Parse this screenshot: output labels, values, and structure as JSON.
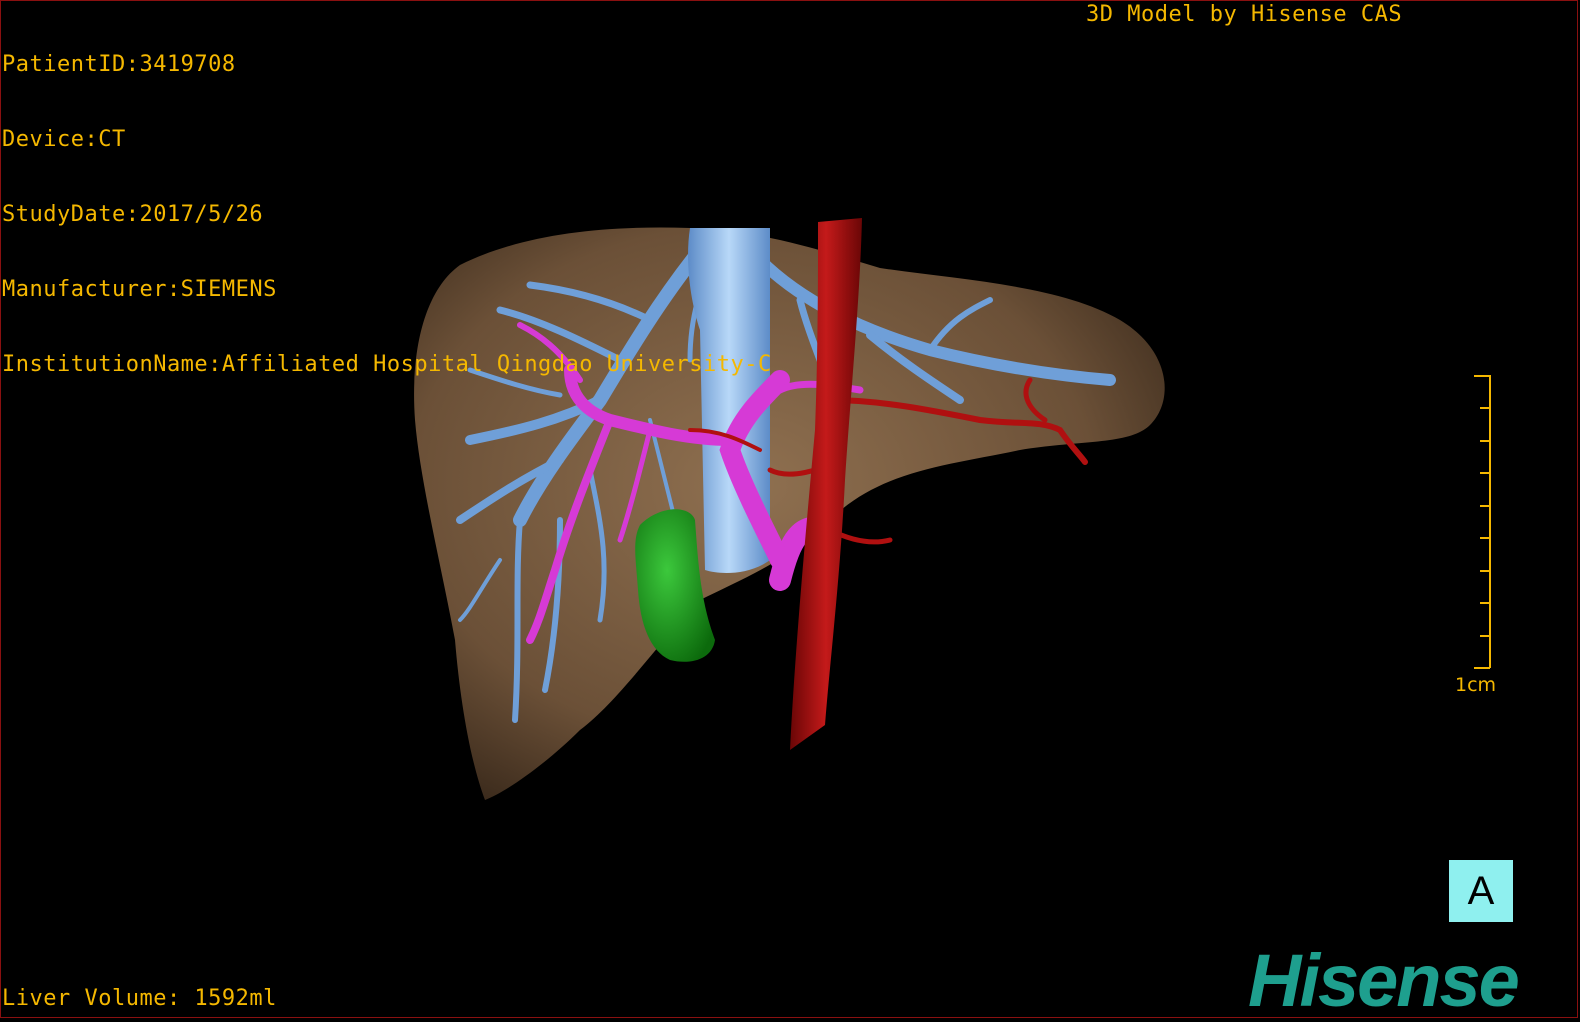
{
  "header": {
    "patient_id": "PatientID:3419708",
    "device": "Device:CT",
    "study_date": "StudyDate:2017/5/26",
    "manufacturer": "Manufacturer:SIEMENS",
    "institution": "InstitutionName:Affiliated Hospital Qingdao University-C",
    "credit": "3D Model by Hisense CAS"
  },
  "footer": {
    "liver_volume": "Liver Volume: 1592ml"
  },
  "scale": {
    "label": "1cm"
  },
  "orientation": {
    "label": "A"
  },
  "logo": {
    "text": "Hisense"
  },
  "colors": {
    "overlay_text": "#f5b800",
    "liver": "#8a6a4a",
    "hepatic_vein": "#6f9fd8",
    "portal_vein": "#d63ad6",
    "artery": "#b01010",
    "gallbladder": "#1f9b1f",
    "badge": "#8ff0ef",
    "logo": "#1e9f8e"
  }
}
